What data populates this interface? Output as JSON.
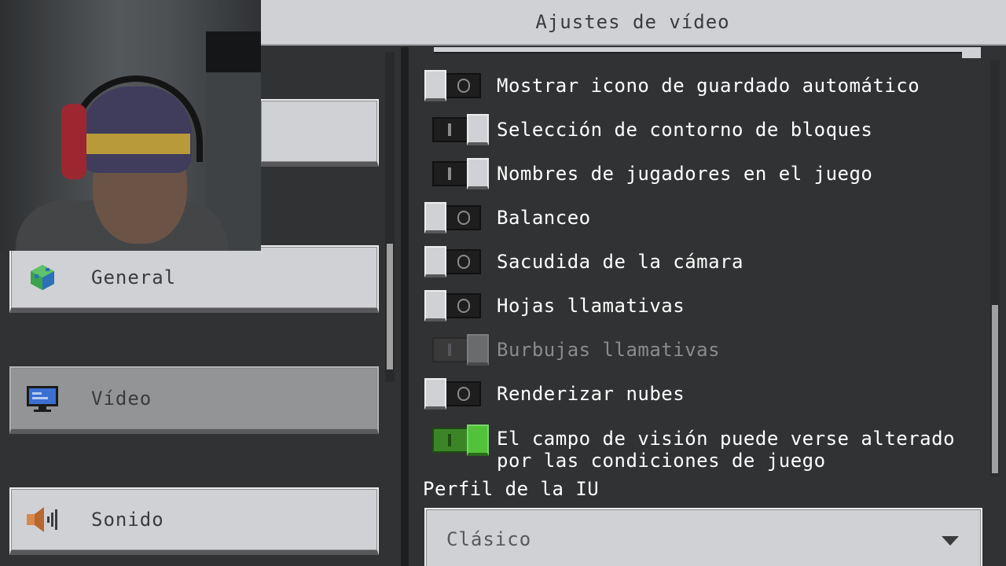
{
  "header": {
    "title": "Ajustes de vídeo"
  },
  "sidebar": {
    "items": [
      {
        "label": "General",
        "icon": "globe-icon",
        "selected": false
      },
      {
        "label": "Vídeo",
        "icon": "monitor-icon",
        "selected": true
      },
      {
        "label": "Sonido",
        "icon": "speaker-icon",
        "selected": false
      }
    ]
  },
  "settings": {
    "toggles": [
      {
        "label": "Mostrar icono de guardado automático",
        "state": "off"
      },
      {
        "label": "Selección de contorno de bloques",
        "state": "on"
      },
      {
        "label": "Nombres de jugadores en el juego",
        "state": "on"
      },
      {
        "label": "Balanceo",
        "state": "off"
      },
      {
        "label": "Sacudida de la cámara",
        "state": "off"
      },
      {
        "label": "Hojas llamativas",
        "state": "off"
      },
      {
        "label": "Burbujas llamativas",
        "state": "on",
        "disabled": true
      },
      {
        "label": "Renderizar nubes",
        "state": "off"
      },
      {
        "label_line1": "El campo de visión puede verse alterado",
        "label_line2": "por las condiciones de juego",
        "state": "on",
        "accent": "green"
      }
    ],
    "ui_profile": {
      "title": "Perfil de la IU",
      "value": "Clásico"
    }
  },
  "colors": {
    "background": "#313233",
    "button": "#d0d1d4",
    "selected_button": "#939496",
    "toggle_on_green": "#52c23a"
  }
}
